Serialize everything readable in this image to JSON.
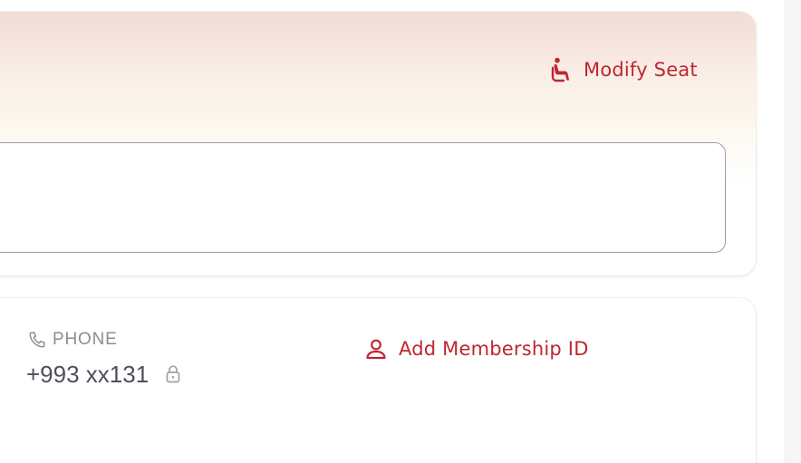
{
  "colors": {
    "accent": "#c0262f",
    "muted_text": "#8a8d96",
    "value_text": "#4d505a",
    "input_border": "#9d9ea6"
  },
  "seat_card": {
    "modify_seat_label": "Modify Seat",
    "modify_seat_icon": "seat-icon",
    "seat_field_value": ""
  },
  "contact_card": {
    "phone": {
      "icon": "phone-icon",
      "label": "PHONE",
      "value": "+993 xx131",
      "lock_icon": "lock-icon"
    },
    "membership": {
      "icon": "user-icon",
      "label": "Add Membership ID"
    }
  }
}
